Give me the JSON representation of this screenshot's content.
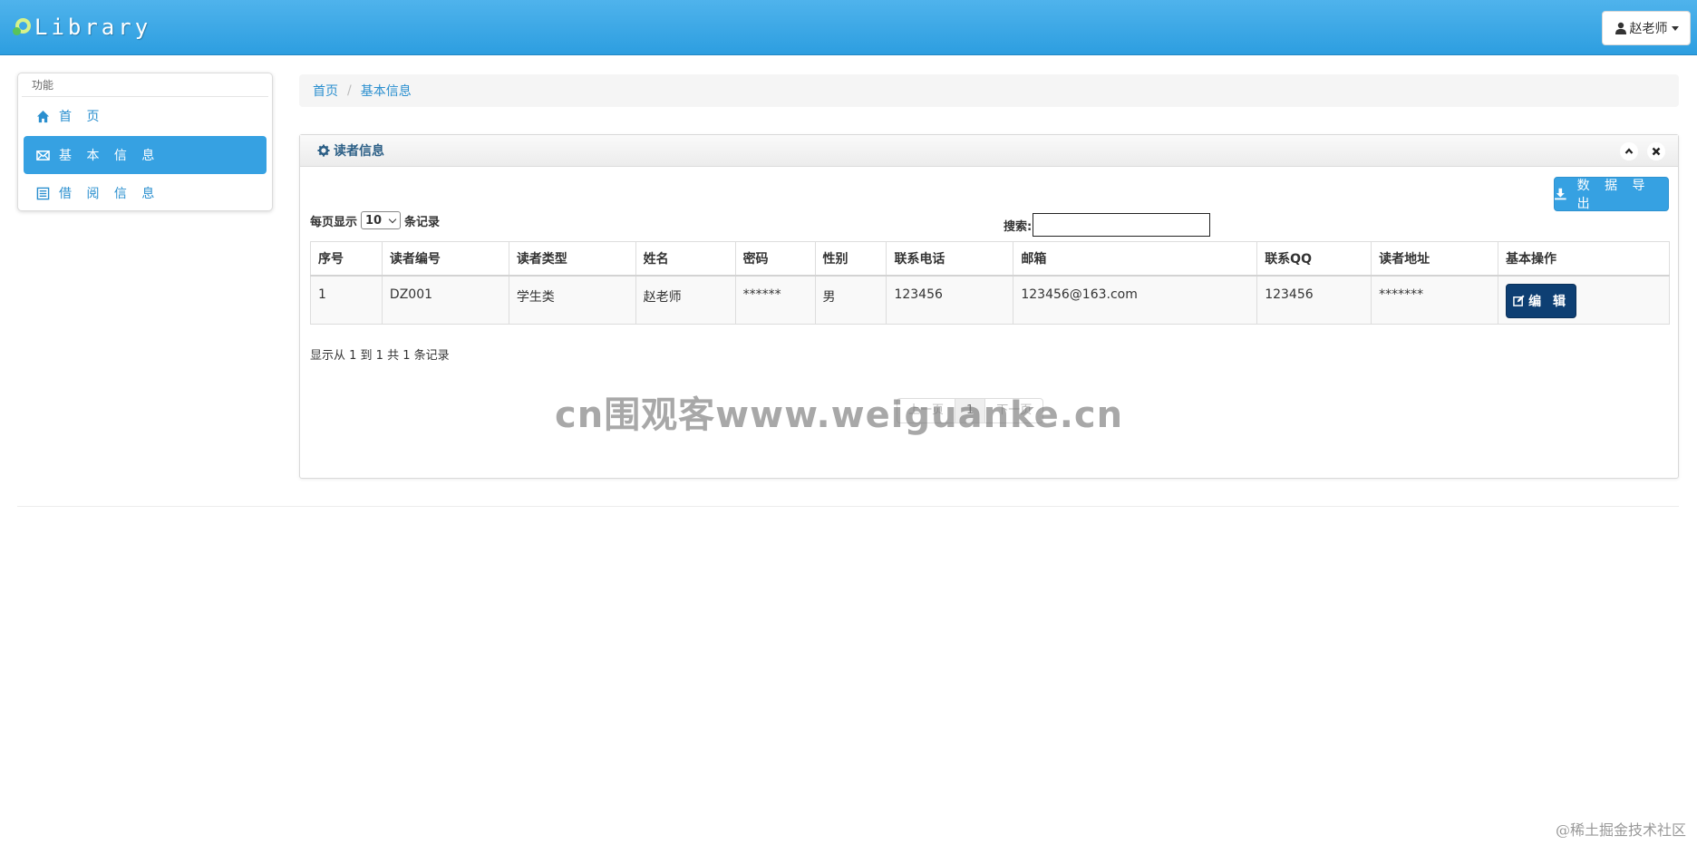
{
  "navbar": {
    "brand": "Library",
    "user_name": "赵老师"
  },
  "sidebar": {
    "header": "功能",
    "items": [
      {
        "label": "首 页",
        "icon": "home-icon",
        "active": false
      },
      {
        "label": "基 本 信 息",
        "icon": "envelope-icon",
        "active": true
      },
      {
        "label": "借 阅 信 息",
        "icon": "list-icon",
        "active": false
      }
    ]
  },
  "breadcrumb": {
    "home": "首页",
    "sep": "/",
    "current": "基本信息"
  },
  "panel": {
    "title": "读者信息",
    "export_label": "数 据 导 出",
    "length_prefix": "每页显示",
    "length_value": "10",
    "length_suffix": "条记录",
    "search_label": "搜索:",
    "search_value": "",
    "info": "显示从 1 到 1 共 1 条记录",
    "pager": {
      "prev": "上一页",
      "current": "1",
      "next": "下一页"
    }
  },
  "table": {
    "headers": [
      "序号",
      "读者编号",
      "读者类型",
      "姓名",
      "密码",
      "性别",
      "联系电话",
      "邮箱",
      "联系QQ",
      "读者地址",
      "基本操作"
    ],
    "rows": [
      [
        "1",
        "DZ001",
        "学生类",
        "赵老师",
        "******",
        "男",
        "123456",
        "123456@163.com",
        "123456",
        "*******"
      ]
    ],
    "edit_label": "编 辑"
  },
  "watermark": "cn围观客www.weiguanke.cn",
  "footer_mark": "@稀土掘金技术社区",
  "colors": {
    "navbar": "#2d9ee0",
    "accent": "#36a1e2",
    "edit_button": "#0e3f73",
    "link": "#2a8fcf"
  }
}
